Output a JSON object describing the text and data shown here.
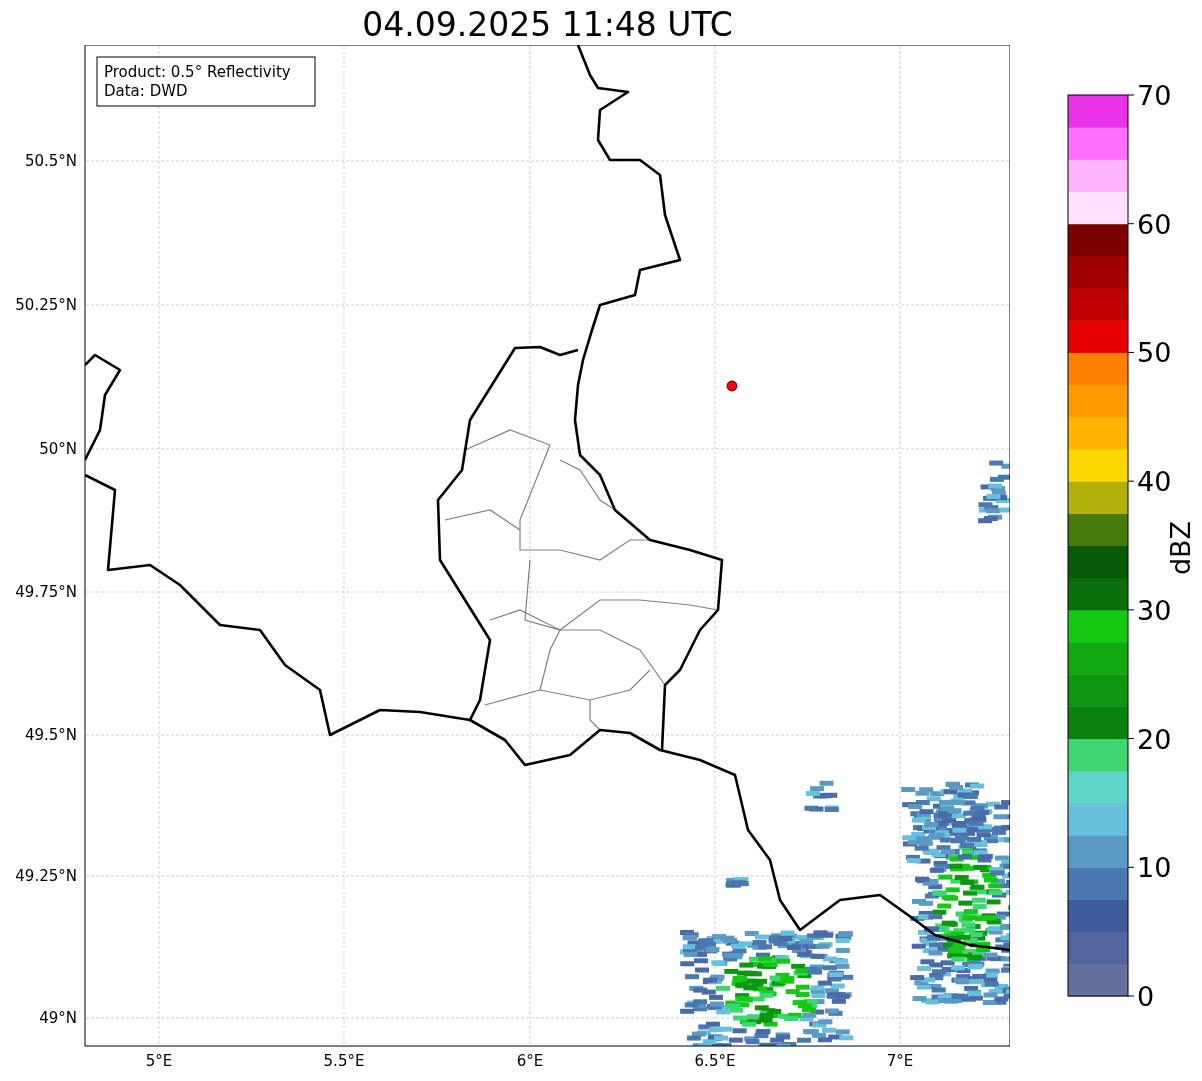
{
  "title": "04.09.2025 11:48 UTC",
  "legend_box": {
    "lines": [
      "Product: 0.5° Reflectivity",
      "Data: DWD"
    ]
  },
  "x_ticks": [
    "5°E",
    "5.5°E",
    "6°E",
    "6.5°E",
    "7°E"
  ],
  "y_ticks": [
    "50.5°N",
    "50.25°N",
    "50°N",
    "49.75°N",
    "49.5°N",
    "49.25°N",
    "49°N"
  ],
  "colorbar": {
    "label": "dBZ",
    "ticks": [
      "70",
      "60",
      "50",
      "40",
      "30",
      "20",
      "10",
      "0"
    ],
    "segments": [
      {
        "color": "#64719f"
      },
      {
        "color": "#52659f"
      },
      {
        "color": "#405aa0"
      },
      {
        "color": "#4a78b0"
      },
      {
        "color": "#5a9ac4"
      },
      {
        "color": "#67c0dc"
      },
      {
        "color": "#60d6c8"
      },
      {
        "color": "#3dd670"
      },
      {
        "color": "#0c820e"
      },
      {
        "color": "#0e9612"
      },
      {
        "color": "#12a812"
      },
      {
        "color": "#14c814"
      },
      {
        "color": "#0a6e0a"
      },
      {
        "color": "#085a08"
      },
      {
        "color": "#477a0a"
      },
      {
        "color": "#b1b10a"
      },
      {
        "color": "#ffd700"
      },
      {
        "color": "#ffb400"
      },
      {
        "color": "#ff9900"
      },
      {
        "color": "#ff7f00"
      },
      {
        "color": "#e60000"
      },
      {
        "color": "#c00000"
      },
      {
        "color": "#a00000"
      },
      {
        "color": "#7c0000"
      },
      {
        "color": "#ffe0ff"
      },
      {
        "color": "#ffb4ff"
      },
      {
        "color": "#ff6eff"
      },
      {
        "color": "#e833e8"
      }
    ]
  }
}
